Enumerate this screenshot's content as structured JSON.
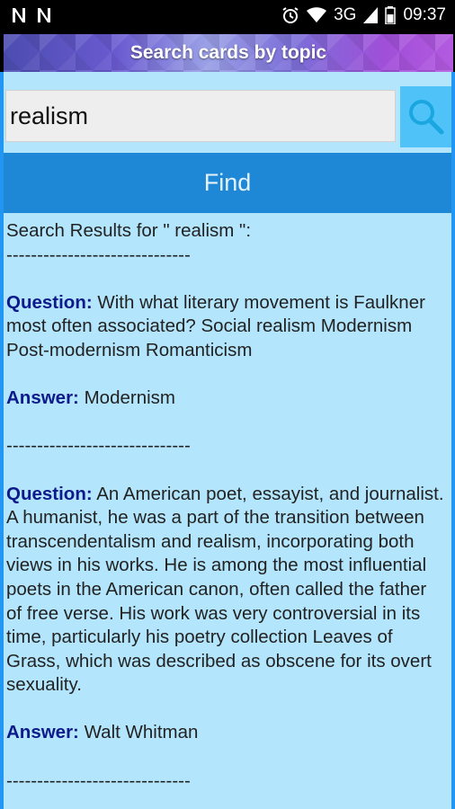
{
  "status_bar": {
    "left_icons": [
      "n-notification-icon",
      "n-notification-icon"
    ],
    "right_icons": [
      "alarm-icon",
      "wifi-icon",
      "signal-icon",
      "battery-icon"
    ],
    "network": "3G",
    "time": "09:37"
  },
  "header": {
    "title": "Search cards by topic"
  },
  "search": {
    "value": "realism",
    "icon": "search-icon"
  },
  "find_button": {
    "label": "Find"
  },
  "results": {
    "heading": "Search Results for \" realism \":",
    "divider": "------------------------------",
    "question_label": "Question:",
    "answer_label": "Answer:",
    "items": [
      {
        "question": " With what literary movement is Faulkner most often associated? Social realism Modernism Post-modernism Romanticism",
        "answer": " Modernism"
      },
      {
        "question": " An American poet, essayist, and journalist. A humanist, he was a part of the transition between transcendentalism and realism, incorporating both views in his works. He is among the most influential poets in the American canon, often called the father of free verse. His work was very controversial in its time, particularly his poetry collection Leaves of Grass, which was described as obscene for its overt sexuality.",
        "answer": " Walt Whitman"
      }
    ]
  },
  "colors": {
    "app_background": "#b3e5fc",
    "find_button": "#1e88d6",
    "search_button": "#4fc3f7",
    "label_color": "#0d1a8c"
  }
}
